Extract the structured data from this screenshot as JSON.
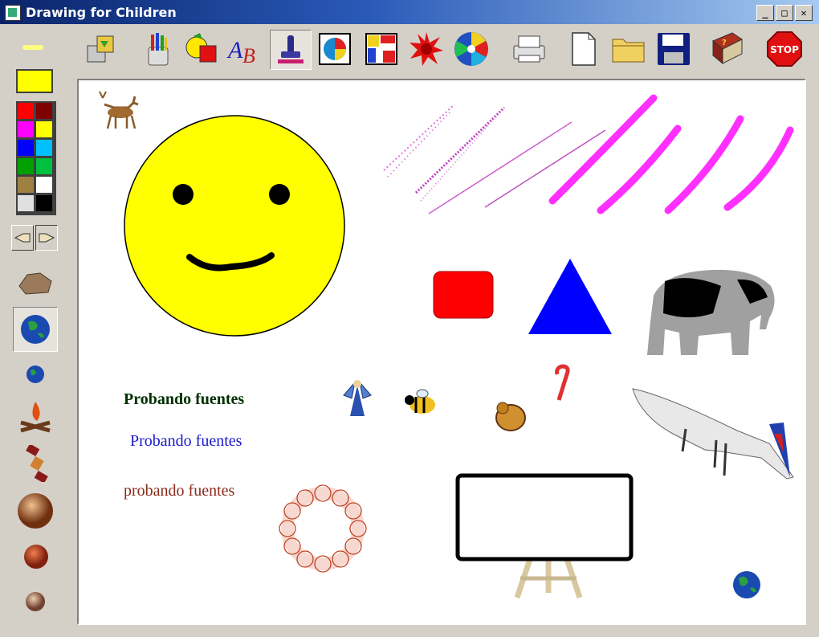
{
  "window": {
    "title": "Drawing for Children"
  },
  "titlebar_buttons": {
    "minimize": "_",
    "maximize": "□",
    "close": "✕"
  },
  "toolbar": [
    {
      "name": "clipart-tool-icon"
    },
    {
      "name": "pencils-tool-icon"
    },
    {
      "name": "shapes-tool-icon"
    },
    {
      "name": "text-tool-icon",
      "glyph": "AB"
    },
    {
      "name": "stamp-tool-icon"
    },
    {
      "name": "pie-fill-tool-icon"
    },
    {
      "name": "frames-tool-icon"
    },
    {
      "name": "splash-tool-icon"
    },
    {
      "name": "spiral-tool-icon"
    },
    {
      "name": "print-icon"
    },
    {
      "name": "new-file-icon"
    },
    {
      "name": "open-folder-icon"
    },
    {
      "name": "save-disk-icon"
    },
    {
      "name": "help-book-icon",
      "glyph": "?"
    },
    {
      "name": "stop-icon",
      "glyph": "STOP"
    }
  ],
  "palette": {
    "current_color": "#ffff00",
    "colors": [
      "#ff0000",
      "#800000",
      "#ff00ff",
      "#ffff00",
      "#0000ff",
      "#00c0ff",
      "#00a000",
      "#00c040",
      "#a08040",
      "#ffffff",
      "#e0e0e0",
      "#000000"
    ]
  },
  "canvas": {
    "texts": [
      {
        "text": "Probando fuentes",
        "color": "#003000"
      },
      {
        "text": "Probando fuentes",
        "color": "#1a1acc"
      },
      {
        "text": "probando fuentes",
        "color": "#8b2a1a"
      }
    ]
  }
}
